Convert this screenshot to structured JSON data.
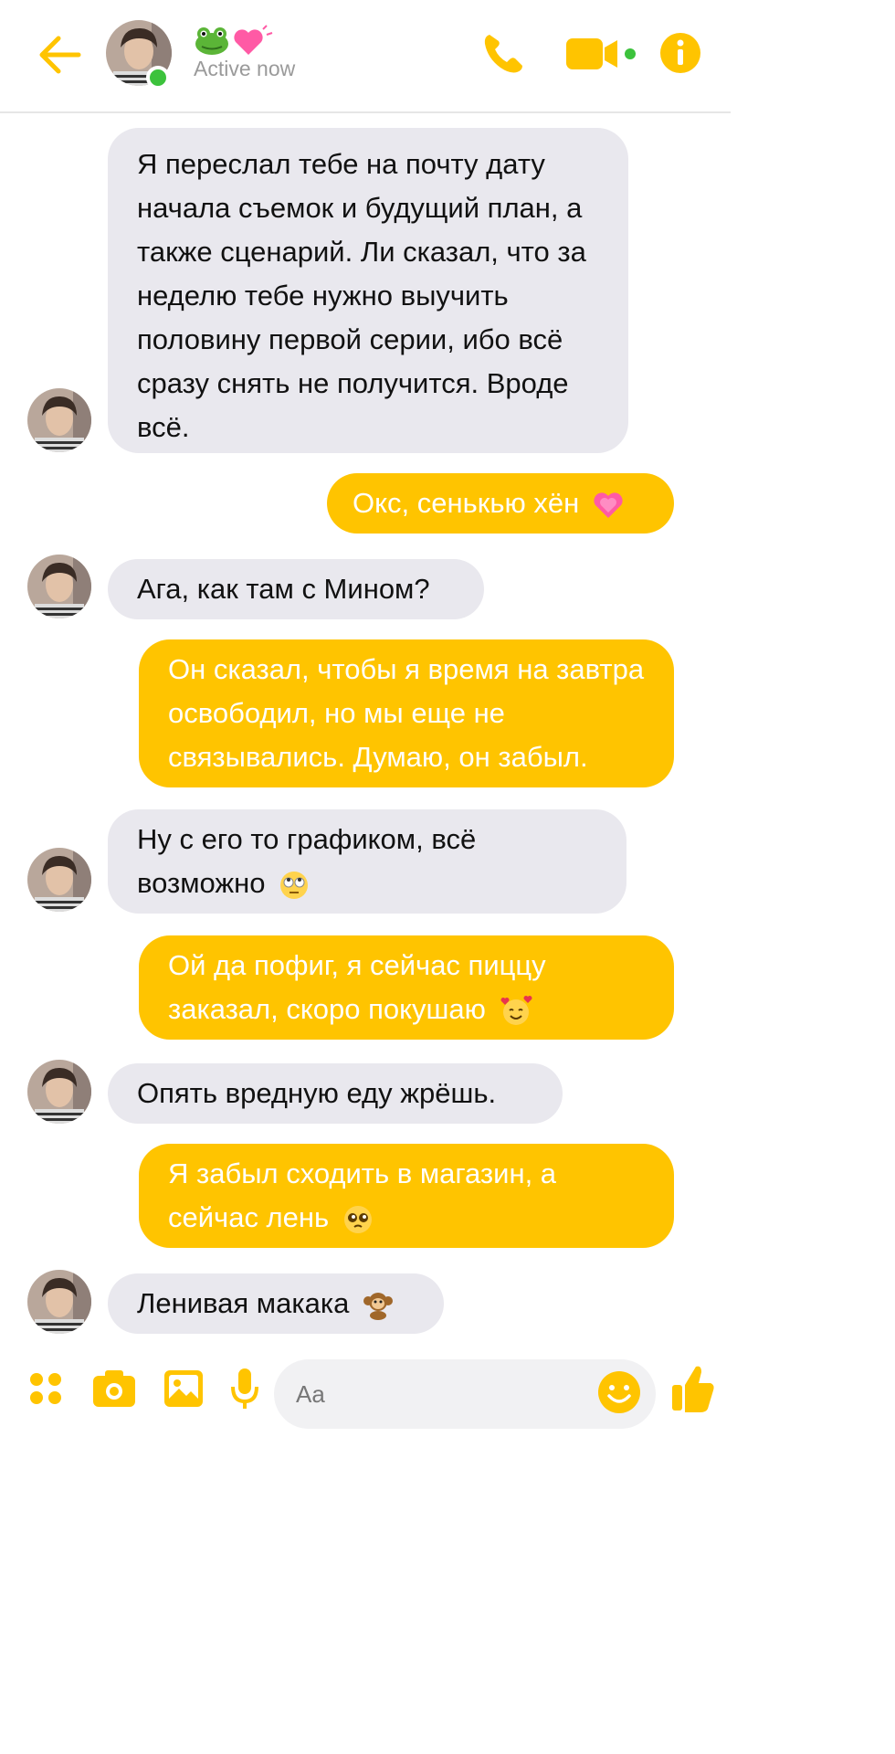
{
  "header": {
    "name_emoji": "🐸💓",
    "status": "Active now"
  },
  "icons": {
    "back": "arrow-left-icon",
    "call": "phone-icon",
    "video": "video-camera-icon",
    "info": "info-icon",
    "more": "four-dots-icon",
    "camera": "camera-icon",
    "gallery": "image-icon",
    "mic": "microphone-icon",
    "emoji": "smiley-icon",
    "like": "thumbs-up-icon"
  },
  "colors": {
    "accent": "#ffc400",
    "incoming_bubble": "#e9e8ee",
    "online": "#3cc23c"
  },
  "messages": [
    {
      "from": "them",
      "text": "Я переслал тебе на почту дату начала съемок и будущий план, а также сценарий. Ли сказал, что за неделю тебе нужно выучить половину первой серии, ибо всё сразу снять не получится. Вроде всё."
    },
    {
      "from": "me",
      "text": "Окс, сенькью хён",
      "emoji": "💓"
    },
    {
      "from": "them",
      "text": "Ага, как там с Мином?"
    },
    {
      "from": "me",
      "text": "Он сказал, чтобы я время на завтра освободил, но мы еще не связывались. Думаю, он забыл."
    },
    {
      "from": "them",
      "text": "Ну с его то графиком, всё возможно",
      "emoji": "🙄"
    },
    {
      "from": "me",
      "text": "Ой да пофиг, я сейчас пиццу заказал, скоро покушаю",
      "emoji": "🥰"
    },
    {
      "from": "them",
      "text": "Опять вредную еду жрёшь."
    },
    {
      "from": "me",
      "text": "Я забыл сходить в магазин, а сейчас лень",
      "emoji": "🥺"
    },
    {
      "from": "them",
      "text": "Ленивая макака",
      "emoji": "🐒"
    }
  ],
  "composer": {
    "placeholder": "Aa"
  }
}
